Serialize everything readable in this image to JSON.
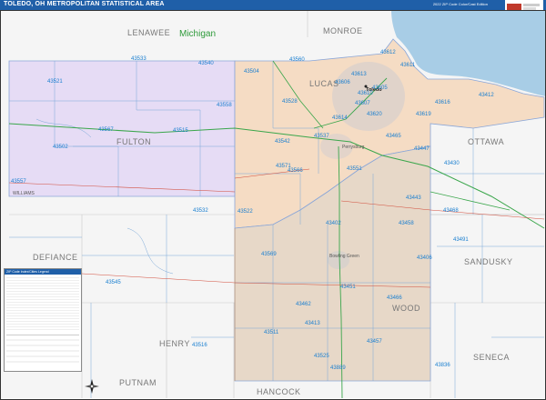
{
  "header": {
    "title": "TOLEDO, OH METROPOLITAN STATISTICAL AREA",
    "edition": "2022 ZIP Code Color/Cast Edition",
    "logo_color": "#c0392b"
  },
  "colors": {
    "title_bar": "#1f5fa8",
    "lucas_fill": "#f5dcc4",
    "wood_fill": "#e7d8c8",
    "fulton_fill": "#e6dcf5",
    "lake": "#a8cde6",
    "zip_label": "#1a7fd0",
    "state_label": "#2e9a3a",
    "county_label": "#777777",
    "boundary": "#7aa8d8",
    "road": "#3aa64b"
  },
  "map": {
    "state_label": "Michigan",
    "counties": [
      {
        "name": "LENAWEE"
      },
      {
        "name": "MONROE"
      },
      {
        "name": "FULTON"
      },
      {
        "name": "LUCAS"
      },
      {
        "name": "OTTAWA"
      },
      {
        "name": "WILLIAMS"
      },
      {
        "name": "DEFIANCE"
      },
      {
        "name": "SANDUSKY"
      },
      {
        "name": "HENRY"
      },
      {
        "name": "WOOD"
      },
      {
        "name": "PUTNAM"
      },
      {
        "name": "SENECA"
      },
      {
        "name": "HANCOCK"
      }
    ],
    "cities": [
      {
        "name": "Toledo"
      },
      {
        "name": "Perrysburg"
      },
      {
        "name": "Bowling Green"
      }
    ],
    "zip_codes": [
      "43533",
      "43540",
      "43504",
      "43560",
      "43613",
      "43612",
      "43611",
      "43521",
      "43606",
      "43610",
      "43605",
      "43412",
      "43558",
      "43528",
      "43607",
      "43620",
      "43616",
      "43567",
      "43515",
      "43614",
      "43619",
      "43502",
      "43542",
      "43537",
      "43465",
      "43447",
      "43571",
      "43566",
      "43551",
      "43430",
      "43557",
      "43443",
      "43532",
      "43522",
      "43402",
      "43468",
      "43458",
      "43491",
      "43569",
      "43406",
      "43545",
      "43451",
      "43466",
      "43462",
      "43413",
      "43511",
      "43516",
      "43457",
      "43525",
      "43889",
      "43836"
    ]
  },
  "legend": {
    "title": "ZIP Code Index/Cities Legend"
  }
}
